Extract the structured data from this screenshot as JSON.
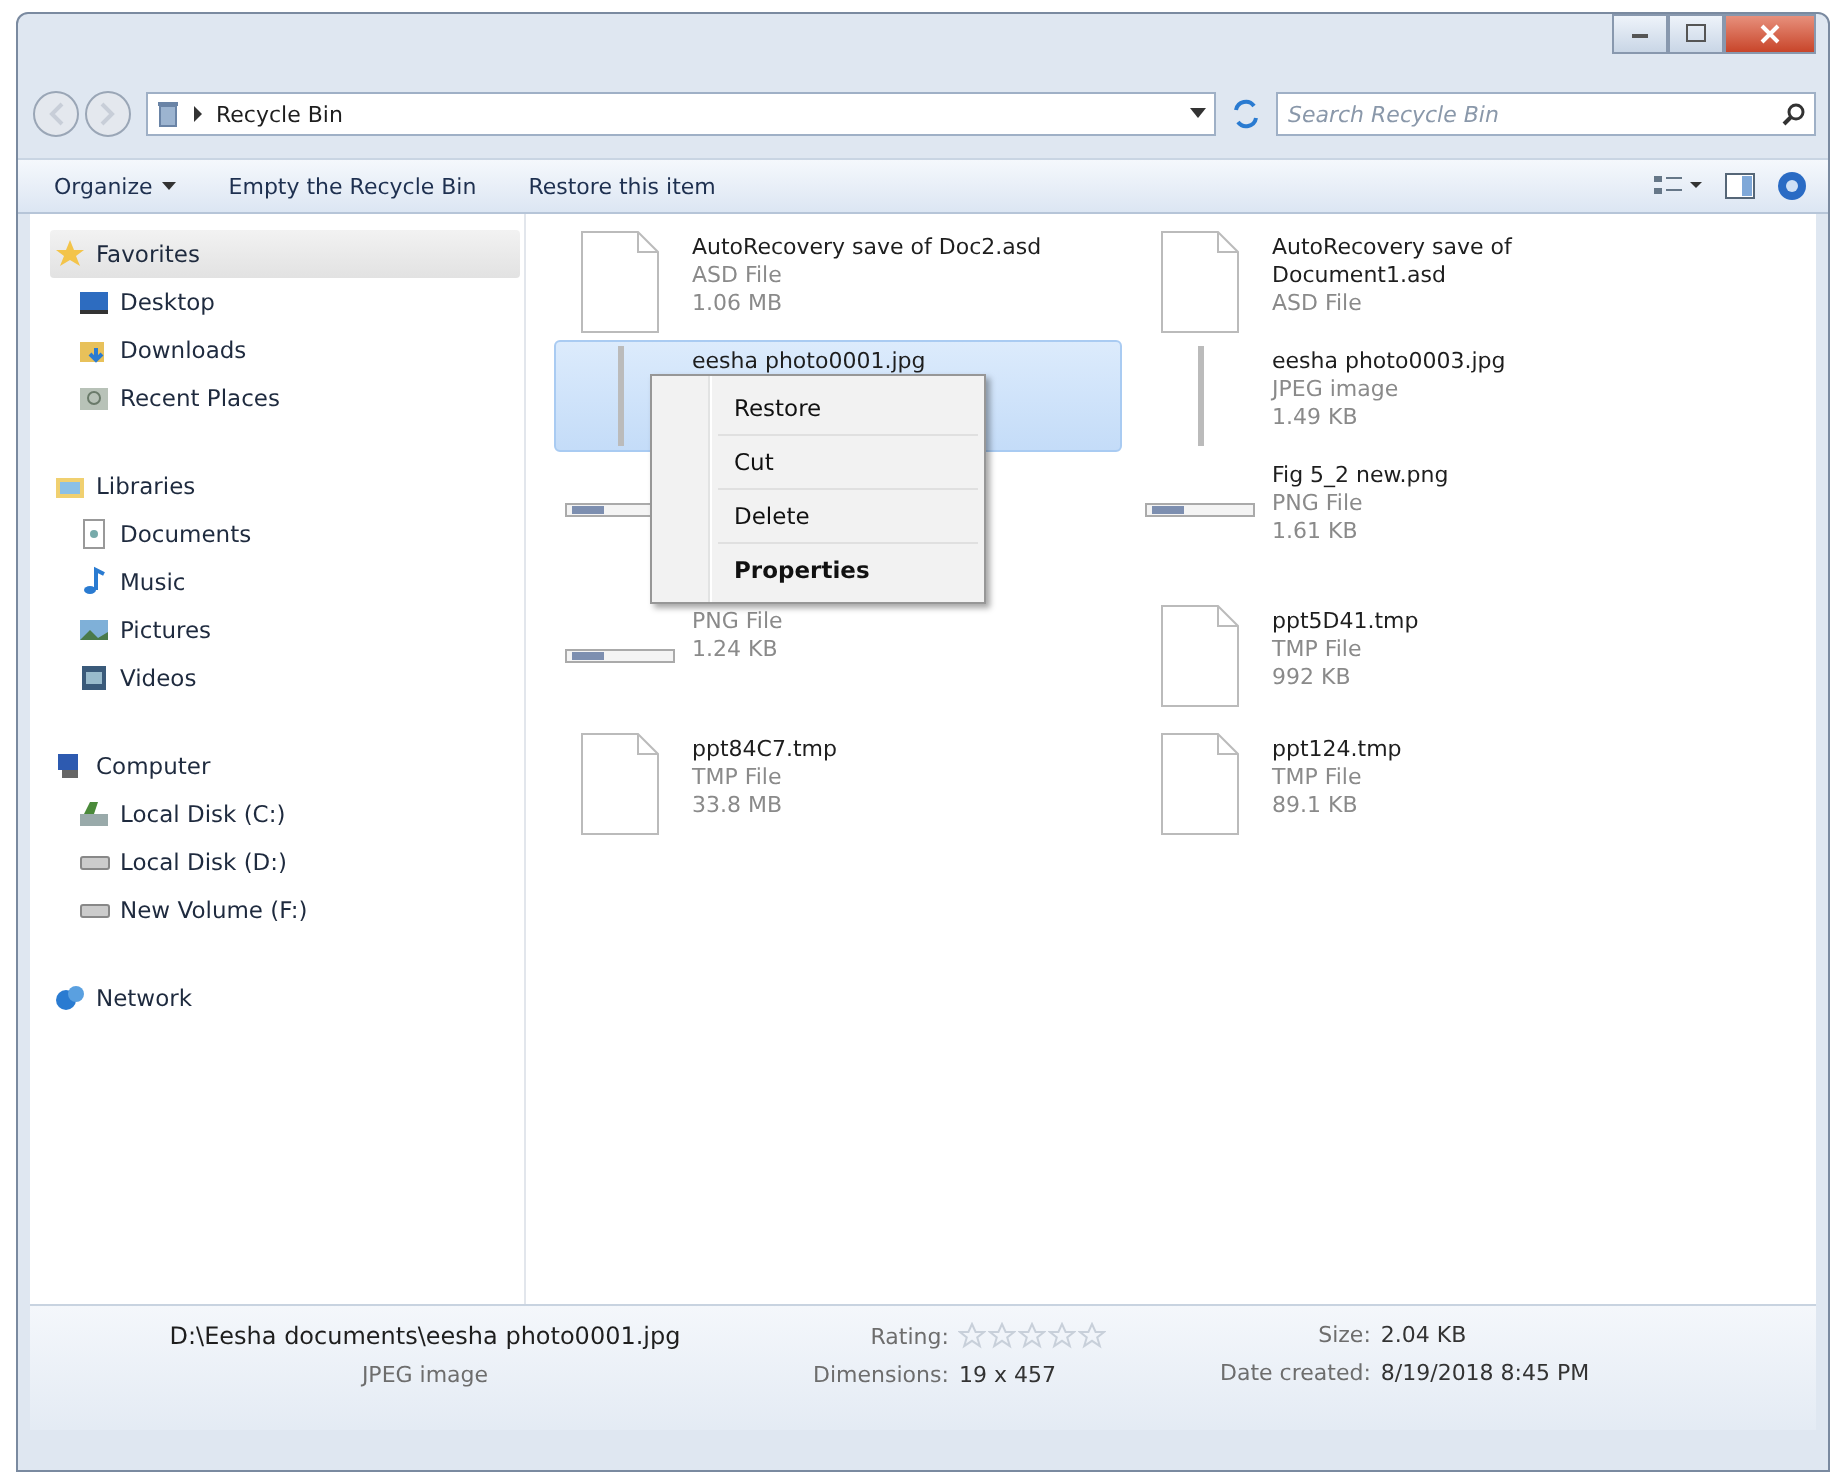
{
  "window": {
    "address": "Recycle Bin",
    "search_placeholder": "Search Recycle Bin"
  },
  "toolbar": [
    {
      "label": "Organize",
      "dropdown": true
    },
    {
      "label": "Empty the Recycle Bin",
      "dropdown": false
    },
    {
      "label": "Restore this item",
      "dropdown": false
    }
  ],
  "sidebar": [
    {
      "label": "Favorites",
      "kind": "star",
      "selected": true,
      "children": [
        {
          "label": "Desktop",
          "kind": "desktop",
          "selected": false
        },
        {
          "label": "Downloads",
          "kind": "download",
          "selected": false
        },
        {
          "label": "Recent Places",
          "kind": "recent",
          "selected": false
        }
      ]
    },
    {
      "label": "Libraries",
      "kind": "library",
      "selected": false,
      "children": [
        {
          "label": "Documents",
          "kind": "doc",
          "selected": false
        },
        {
          "label": "Music",
          "kind": "music",
          "selected": false
        },
        {
          "label": "Pictures",
          "kind": "picture",
          "selected": false
        },
        {
          "label": "Videos",
          "kind": "video",
          "selected": false
        }
      ]
    },
    {
      "label": "Computer",
      "kind": "computer",
      "selected": false,
      "children": [
        {
          "label": "Local Disk (C:)",
          "kind": "sysdisk",
          "selected": false
        },
        {
          "label": "Local Disk (D:)",
          "kind": "disk",
          "selected": false
        },
        {
          "label": "New Volume (F:)",
          "kind": "disk",
          "selected": false
        }
      ]
    },
    {
      "label": "Network",
      "kind": "network",
      "selected": false
    }
  ],
  "files": [
    {
      "name": "AutoRecovery save of Doc2.asd",
      "type": "ASD File",
      "size": "1.06 MB",
      "kind": "page",
      "selected": false
    },
    {
      "name": "AutoRecovery save of Document1.asd",
      "type": "ASD File",
      "kind": "page",
      "selected": false
    },
    {
      "name": "eesha photo0001.jpg",
      "kind": "tall",
      "selected": true
    },
    {
      "name": "eesha photo0003.jpg",
      "type": "JPEG image",
      "size": "1.49 KB",
      "kind": "tall",
      "selected": false
    },
    {
      "kind": "strip",
      "selected": false
    },
    {
      "name": "Fig 5_2 new.png",
      "type": "PNG File",
      "size": "1.61 KB",
      "kind": "strip",
      "selected": false
    },
    {
      "type": "PNG File",
      "size": "1.24 KB",
      "kind": "strip",
      "selected": false
    },
    {
      "name": "ppt5D41.tmp",
      "type": "TMP File",
      "size": "992 KB",
      "kind": "page",
      "selected": false
    },
    {
      "name": "ppt84C7.tmp",
      "type": "TMP File",
      "size": "33.8 MB",
      "kind": "page",
      "selected": false
    },
    {
      "name": "ppt124.tmp",
      "type": "TMP File",
      "size": "89.1 KB",
      "kind": "page",
      "selected": false
    }
  ],
  "context_menu": [
    {
      "label": "Restore",
      "default": false
    },
    {
      "label": "Cut",
      "default": false
    },
    {
      "label": "Delete",
      "default": false
    },
    {
      "label": "Properties",
      "default": true
    }
  ],
  "details": {
    "path": "D:\\Eesha documents\\eesha photo0001.jpg",
    "type": "JPEG image",
    "rating_label": "Rating:",
    "stars": 0,
    "dimensions_label": "Dimensions:",
    "dimensions": "19 x 457",
    "size_label": "Size:",
    "size": "2.04 KB",
    "date_label": "Date created:",
    "date": "8/19/2018 8:45 PM"
  }
}
